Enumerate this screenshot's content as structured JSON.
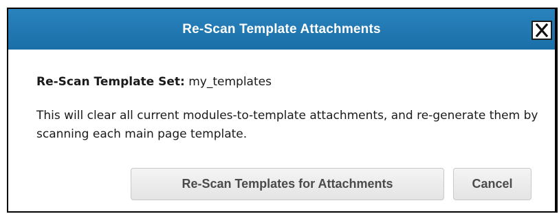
{
  "dialog": {
    "title": "Re-Scan Template Attachments",
    "close_label": "X",
    "template_set_label": "Re-Scan Template Set:",
    "template_set_value": " my_templates",
    "description": "This will clear all current modules-to-template attachments, and re-generate them by scanning each main page template.",
    "rescan_button_label": "Re-Scan Templates for Attachments",
    "cancel_button_label": "Cancel"
  },
  "colors": {
    "titlebar": "#1a6fa8",
    "titlebar_text": "#ffffff",
    "button_text": "#4a4a4a",
    "button_bg": "#eeeeee"
  }
}
